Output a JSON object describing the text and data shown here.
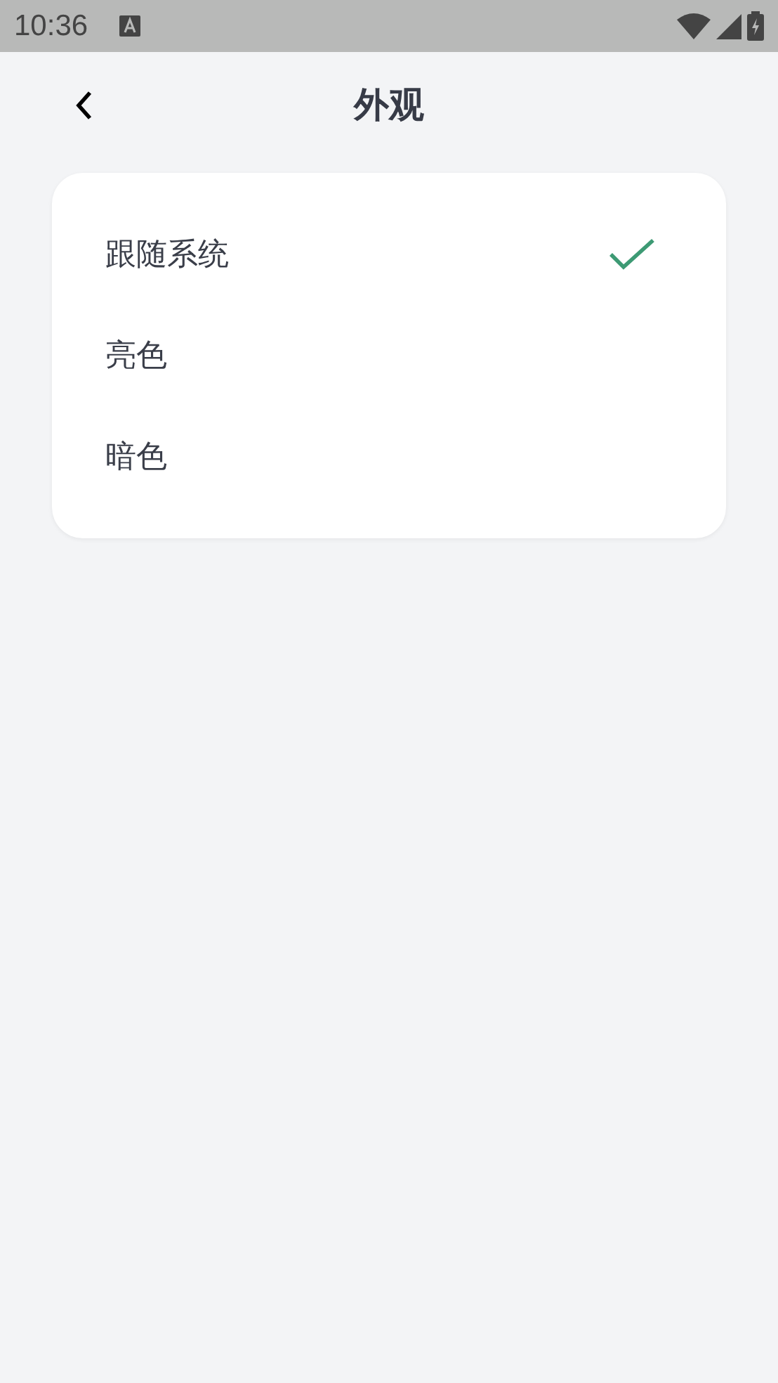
{
  "status_bar": {
    "time": "10:36"
  },
  "header": {
    "title": "外观"
  },
  "options": [
    {
      "label": "跟随系统",
      "selected": true
    },
    {
      "label": "亮色",
      "selected": false
    },
    {
      "label": "暗色",
      "selected": false
    }
  ]
}
